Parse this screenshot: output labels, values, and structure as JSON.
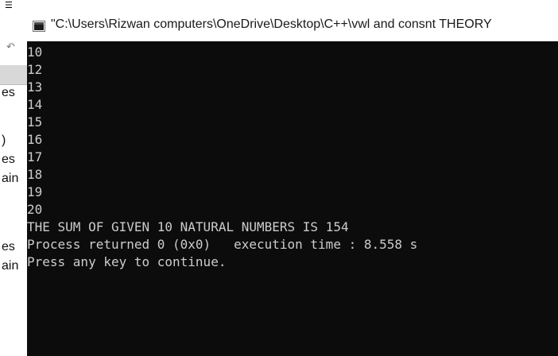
{
  "background_ide": {
    "fragments": [
      "es",
      ")",
      "es",
      "ain",
      "es",
      "ain"
    ]
  },
  "window": {
    "title": "\"C:\\Users\\Rizwan computers\\OneDrive\\Desktop\\C++\\vwl and consnt THEORY",
    "icon": "console-window-icon"
  },
  "console": {
    "lines": [
      "10",
      "12",
      "13",
      "14",
      "15",
      "16",
      "17",
      "18",
      "19",
      "20",
      "THE SUM OF GIVEN 10 NATURAL NUMBERS IS 154",
      "Process returned 0 (0x0)   execution time : 8.558 s",
      "Press any key to continue."
    ],
    "colors": {
      "background": "#0c0c0c",
      "text": "#cccccc"
    }
  }
}
